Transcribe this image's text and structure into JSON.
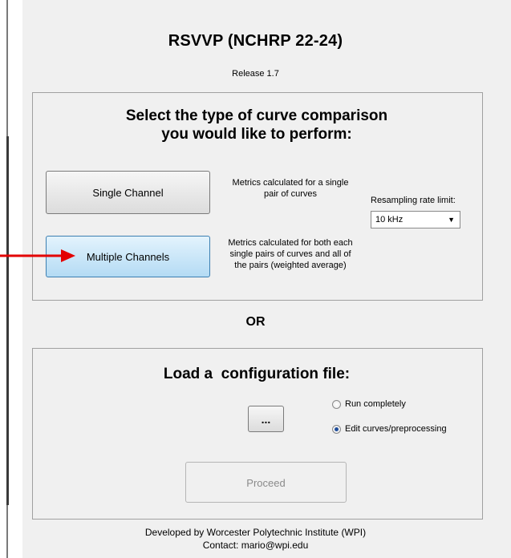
{
  "title": "RSVVP (NCHRP 22-24)",
  "release": "Release 1.7",
  "comparison": {
    "heading_line1": "Select the type of curve comparison",
    "heading_line2": "you would like to perform:",
    "single_button": "Single Channel",
    "single_desc_line1": "Metrics calculated for a single",
    "single_desc_line2": "pair of curves",
    "multi_button": "Multiple Channels",
    "multi_desc_line1": "Metrics calculated for both each",
    "multi_desc_line2": "single pairs of curves and all of",
    "multi_desc_line3": "the pairs (weighted average)",
    "resampling_label": "Resampling rate limit:",
    "resampling_value": "10 kHz"
  },
  "or_label": "OR",
  "config": {
    "heading": "Load a  configuration file:",
    "browse_button": "...",
    "radio_run": "Run completely",
    "radio_edit": "Edit curves/preprocessing",
    "selected": "radio_edit",
    "proceed_button": "Proceed"
  },
  "footer": {
    "line1": "Developed by Worcester Polytechnic Institute (WPI)",
    "line2": "Contact: mario@wpi.edu"
  },
  "colors": {
    "background": "#f0f0f0",
    "annotation_arrow": "#e30000",
    "highlight_button": "#b4dbf4"
  },
  "icons": {
    "annotation": "red-arrow-icon",
    "dropdown": "chevron-down-icon"
  }
}
